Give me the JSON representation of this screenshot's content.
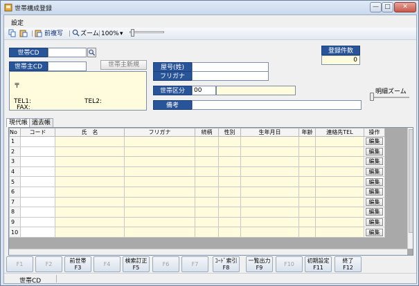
{
  "window": {
    "title": "世帯構成登録"
  },
  "menu": {
    "settings": "設定"
  },
  "toolbar": {
    "copy_prev": "前複写",
    "zoom": "ズーム",
    "zoom_level": "100%"
  },
  "form": {
    "household_cd_label": "世帯CD",
    "household_cd_value": "",
    "head_cd_label": "世帯主CD",
    "head_cd_value": "",
    "new_head_button": "世帯主新規",
    "postal_mark": "〒",
    "tel1": "TEL1:",
    "tel2": "TEL2:",
    "fax": "FAX:",
    "shop_name_label": "屋号(姓)",
    "furigana_label": "フリガナ",
    "household_class_label": "世帯区分",
    "household_class_code": "00",
    "notes_label": "備考",
    "registered_count_label": "登録件数",
    "registered_count_value": "0",
    "detail_zoom_label": "明細ズーム"
  },
  "tabs": [
    {
      "label": "現代帳"
    },
    {
      "label": "過去帳"
    }
  ],
  "grid": {
    "headers": [
      "No",
      "コード",
      "氏　名",
      "フリガナ",
      "続柄",
      "性別",
      "生年月日",
      "年齢",
      "連絡先TEL",
      "操作"
    ],
    "rows": [
      "1",
      "2",
      "3",
      "4",
      "5",
      "6",
      "7",
      "8",
      "9",
      "10"
    ],
    "edit_label": "編集"
  },
  "fkeys": [
    {
      "top": "",
      "bottom": "F1",
      "enabled": false
    },
    {
      "top": "",
      "bottom": "F2",
      "enabled": false
    },
    {
      "top": "前世帯",
      "bottom": "F3",
      "enabled": true
    },
    {
      "top": "",
      "bottom": "F4",
      "enabled": false
    },
    {
      "top": "検索訂正",
      "bottom": "F5",
      "enabled": true
    },
    {
      "top": "",
      "bottom": "F6",
      "enabled": false
    },
    {
      "top": "",
      "bottom": "F7",
      "enabled": false
    },
    {
      "top": "ｺｰﾄﾞ索引",
      "bottom": "F8",
      "enabled": true
    },
    {
      "top": "一覧出力",
      "bottom": "F9",
      "enabled": true
    },
    {
      "top": "",
      "bottom": "F10",
      "enabled": false
    },
    {
      "top": "初期設定",
      "bottom": "F11",
      "enabled": true
    },
    {
      "top": "終了",
      "bottom": "F12",
      "enabled": true
    }
  ],
  "status": {
    "field": "世帯CD"
  },
  "colors": {
    "label_blue": "#28549a",
    "input_yellow": "#fffbdd"
  }
}
